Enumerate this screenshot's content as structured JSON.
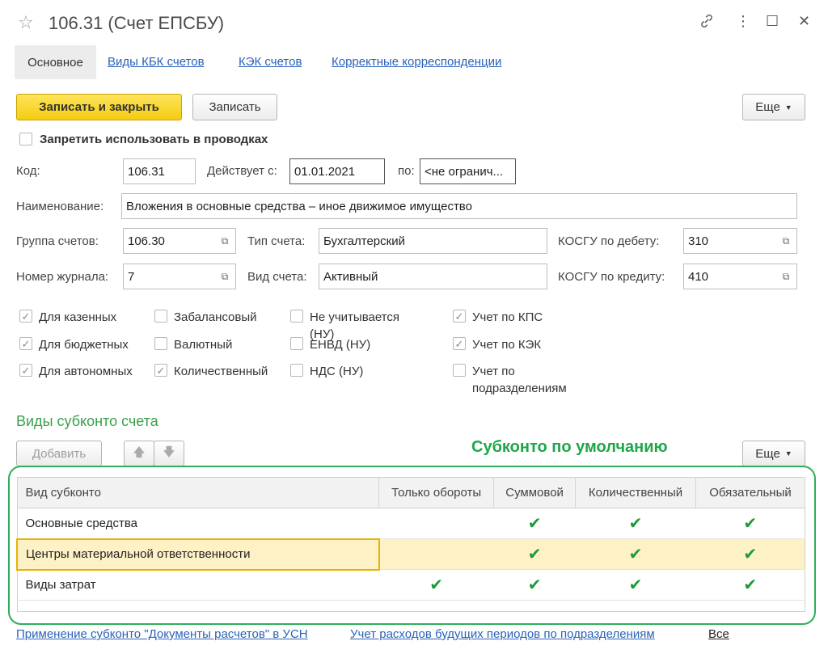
{
  "window": {
    "title": "106.31 (Счет ЕПСБУ)",
    "star_icon": "star-icon",
    "controls": [
      "link-icon",
      "more-icon",
      "maximize-icon",
      "close-icon"
    ],
    "link_glyph": "🔗",
    "more_glyph": "⋮",
    "max_glyph": "☐",
    "close_glyph": "✕"
  },
  "tabs": {
    "main": "Основное",
    "kbk": "Виды КБК счетов",
    "kek": "КЭК счетов",
    "corr": "Корректные корреспонденции"
  },
  "toolbar": {
    "save_close": "Записать и закрыть",
    "save": "Записать",
    "more": "Еще"
  },
  "form": {
    "prohibit_label": "Запретить использовать в проводках",
    "code_label": "Код:",
    "code_value": "106.31",
    "valid_from_label": "Действует с:",
    "valid_from_value": "01.01.2021",
    "to_label": "по:",
    "to_value": "<не огранич...",
    "name_label": "Наименование:",
    "name_value": "Вложения в основные средства – иное движимое имущество",
    "group_label": "Группа счетов:",
    "group_value": "106.30",
    "type_label": "Тип счета:",
    "type_value": "Бухгалтерский",
    "kosgu_debit_label": "КОСГУ по дебету:",
    "kosgu_debit_value": "310",
    "journal_label": "Номер журнала:",
    "journal_value": "7",
    "kind_label": "Вид счета:",
    "kind_value": "Активный",
    "kosgu_credit_label": "КОСГУ по кредиту:",
    "kosgu_credit_value": "410"
  },
  "flags": {
    "col1": [
      {
        "label": "Для казенных",
        "checked": true
      },
      {
        "label": "Для бюджетных",
        "checked": true
      },
      {
        "label": "Для автономных",
        "checked": true
      }
    ],
    "col2": [
      {
        "label": "Забалансовый",
        "checked": false
      },
      {
        "label": "Валютный",
        "checked": false
      },
      {
        "label": "Количественный",
        "checked": true
      }
    ],
    "col3": [
      {
        "label": "Не учитывается (НУ)",
        "checked": false
      },
      {
        "label": "ЕНВД (НУ)",
        "checked": false
      },
      {
        "label": "НДС (НУ)",
        "checked": false
      }
    ],
    "col4": [
      {
        "label": "Учет по КПС",
        "checked": true
      },
      {
        "label": "Учет по КЭК",
        "checked": true
      },
      {
        "label": "Учет по подразделениям",
        "checked": false
      }
    ]
  },
  "subconto": {
    "section_title": "Виды субконто счета",
    "add_button": "Добавить",
    "more_button": "Еще",
    "annotation": "Субконто по умолчанию",
    "columns": [
      "Вид субконто",
      "Только обороты",
      "Суммовой",
      "Количественный",
      "Обязательный"
    ],
    "rows": [
      {
        "name": "Основные средства",
        "turnover": "",
        "sum": "✔",
        "qty": "✔",
        "required": "✔"
      },
      {
        "name": "Центры материальной ответственности",
        "turnover": "",
        "sum": "✔",
        "qty": "✔",
        "required": "✔"
      },
      {
        "name": "Виды затрат",
        "turnover": "✔",
        "sum": "✔",
        "qty": "✔",
        "required": "✔"
      }
    ]
  },
  "footer": {
    "link1": "Применение субконто \"Документы расчетов\" в УСН",
    "link2": "Учет расходов будущих периодов по подразделениям",
    "all": "Все"
  }
}
